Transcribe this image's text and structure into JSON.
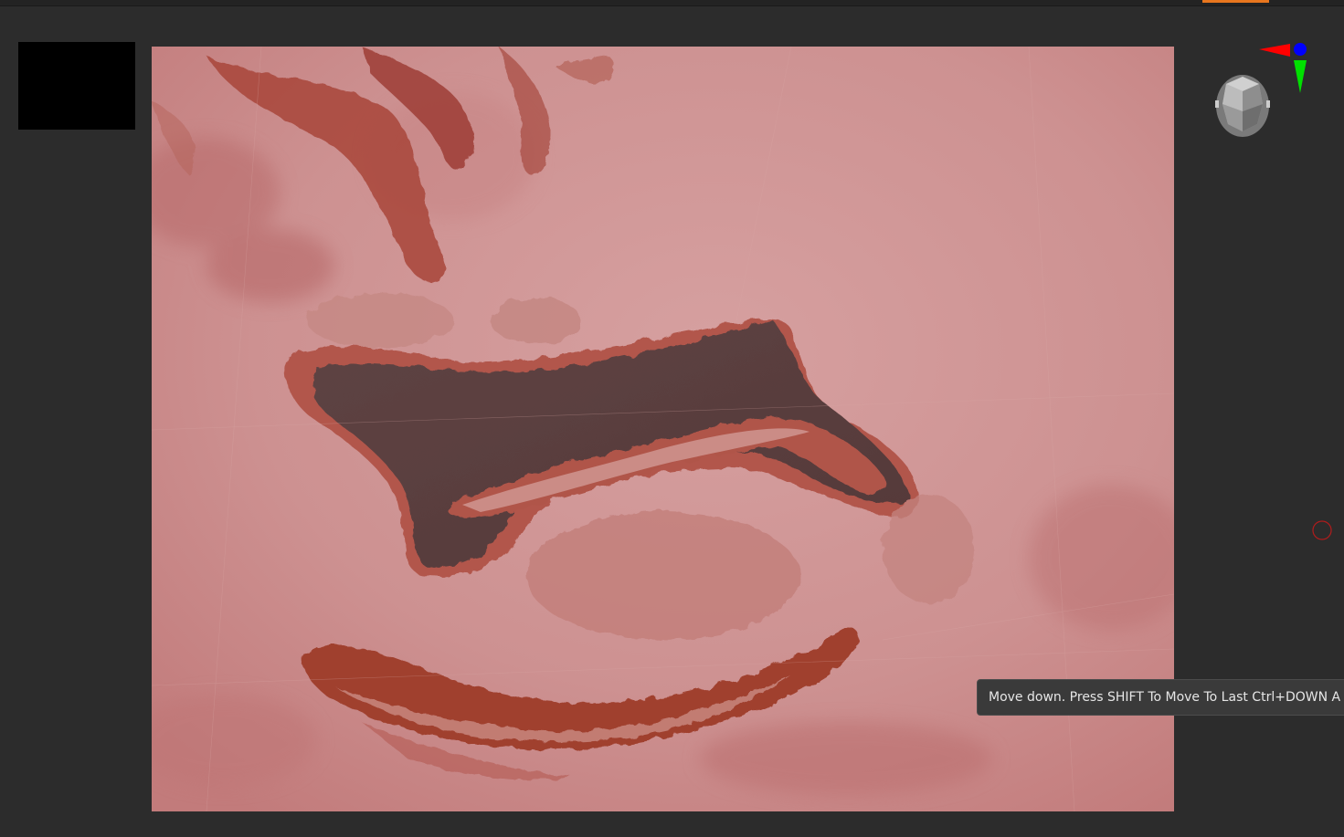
{
  "tooltip": {
    "text": "Move down. Press SHIFT To Move To Last  Ctrl+DOWN A"
  },
  "colors": {
    "background": "#2c2c2c",
    "active_tab_accent": "#e8761e",
    "mesh_base": "#c98a8a",
    "mesh_ridge": "#8a2e22",
    "mesh_basin": "#5a3e3e",
    "gyro_x": "#ff0000",
    "gyro_y": "#00ff00",
    "gyro_z": "#0000ff"
  },
  "icons": {
    "gyro": "navigation-gyro-icon",
    "cursor": "brush-cursor-icon"
  }
}
